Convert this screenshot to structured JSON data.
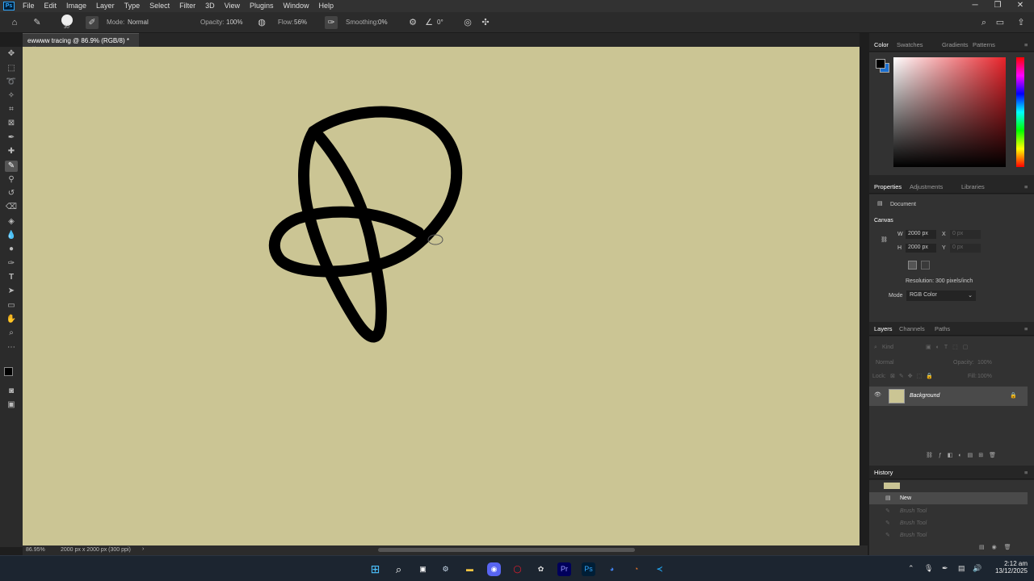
{
  "menubar": {
    "app_icon": "Ps",
    "items": [
      "File",
      "Edit",
      "Image",
      "Layer",
      "Type",
      "Select",
      "Filter",
      "3D",
      "View",
      "Plugins",
      "Window",
      "Help"
    ]
  },
  "options": {
    "brush_size": "30",
    "mode_label": "Mode:",
    "mode_value": "Normal",
    "opacity_label": "Opacity:",
    "opacity_value": "100%",
    "flow_label": "Flow:",
    "flow_value": "56%",
    "smoothing_label": "Smoothing:",
    "smoothing_value": "0%",
    "angle_value": "0°"
  },
  "document": {
    "tab_title": "ewwww tracing @ 86.9% (RGB/8) *",
    "canvas_color": "#cbc594",
    "stroke_color": "#000000"
  },
  "status": {
    "zoom": "86.95%",
    "info": "2000 px x 2000 px (300 ppi)"
  },
  "color_panel": {
    "tabs": [
      "Color",
      "Swatches",
      "Gradients",
      "Patterns"
    ],
    "foreground": "#000000",
    "background": "#1a6fd0"
  },
  "properties_panel": {
    "tabs": [
      "Properties",
      "Adjustments",
      "Libraries"
    ],
    "type": "Document",
    "section": "Canvas",
    "w_label": "W",
    "w_value": "2000 px",
    "h_label": "H",
    "h_value": "2000 px",
    "x_label": "X",
    "x_value": "0 px",
    "y_label": "Y",
    "y_value": "0 px",
    "resolution": "Resolution: 300 pixels/inch",
    "mode_label": "Mode",
    "mode_value": "RGB Color"
  },
  "layers_panel": {
    "tabs": [
      "Layers",
      "Channels",
      "Paths"
    ],
    "kind_placeholder": "Kind",
    "blend_mode": "Normal",
    "opacity_label": "Opacity:",
    "opacity_value": "100%",
    "lock_label": "Lock:",
    "fill_label": "Fill:",
    "fill_value": "100%",
    "layers": [
      {
        "name": "Background"
      }
    ]
  },
  "history_panel": {
    "title": "History",
    "items": [
      "New",
      "Brush Tool",
      "Brush Tool",
      "Brush Tool"
    ]
  },
  "taskbar": {
    "time": "2:12 am",
    "date": "13/12/2025"
  }
}
